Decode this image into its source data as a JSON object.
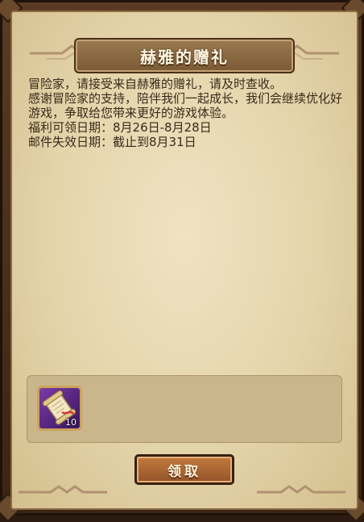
{
  "dialog": {
    "title": "赫雅的赠礼"
  },
  "message": {
    "line1": "冒险家，请接受来自赫雅的赠礼，请及时查收。",
    "line2": "感谢冒险家的支持，陪伴我们一起成长，我们会继续优化好游戏，争取给您带来更好的游戏体验。",
    "claim_period": "福利可领日期：8月26日-8月28日",
    "expiry": "邮件失效日期：截止到8月31日"
  },
  "reward": {
    "items": [
      {
        "icon": "scroll-icon",
        "count": "10",
        "rarity_color": "#7a3aa6"
      }
    ]
  },
  "actions": {
    "claim_label": "领取"
  },
  "colors": {
    "parchment": "#e4d4aa",
    "frame": "#5a3a22",
    "button": "#b06a34"
  }
}
